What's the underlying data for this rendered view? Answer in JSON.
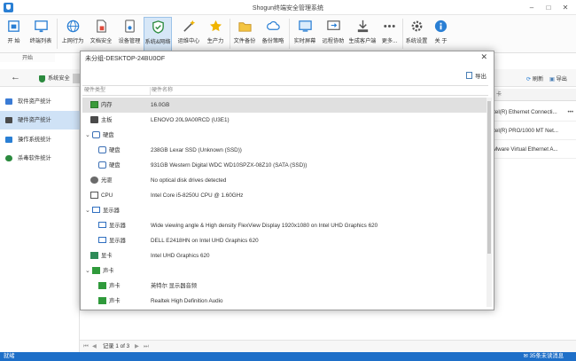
{
  "window": {
    "title": "Shogun终端安全管理系统"
  },
  "ribbon": {
    "buttons": [
      {
        "label": "开 始",
        "icon": "home-icon"
      },
      {
        "label": "终端列表",
        "icon": "monitor-list-icon"
      },
      {
        "label": "上网行为",
        "icon": "globe-icon"
      },
      {
        "label": "文档安全",
        "icon": "document-icon"
      },
      {
        "label": "设备管理",
        "icon": "device-icon"
      },
      {
        "label": "系统&网络",
        "icon": "shield-icon"
      },
      {
        "label": "运维中心",
        "icon": "wand-icon"
      },
      {
        "label": "生产力",
        "icon": "star-icon"
      },
      {
        "label": "文件备份",
        "icon": "folder-icon"
      },
      {
        "label": "备份策略",
        "icon": "cloud-icon"
      },
      {
        "label": "实时屏幕",
        "icon": "screen-icon"
      },
      {
        "label": "远程协助",
        "icon": "remote-icon"
      },
      {
        "label": "生成客户端",
        "icon": "download-icon"
      },
      {
        "label": "更多...",
        "icon": "more-icon"
      },
      {
        "label": "系统设置",
        "icon": "gear-icon"
      },
      {
        "label": "关 于",
        "icon": "info-icon"
      }
    ],
    "group_label": "开始"
  },
  "nav": {
    "tab_label": "系统安全",
    "refresh_label": "刷新",
    "export_label": "导出"
  },
  "sidebar": {
    "items": [
      {
        "label": "软件资产统计"
      },
      {
        "label": "硬件资产统计"
      },
      {
        "label": "操作系统统计"
      },
      {
        "label": "杀毒软件统计"
      }
    ]
  },
  "background_list": {
    "header": "卡",
    "rows": [
      "Intel(R) Ethernet Connecti...",
      "Intel(R) PRO/1000 MT Net...",
      "VMware Virtual Ethernet A..."
    ]
  },
  "pager": {
    "text": "记录 1 of 3"
  },
  "status": {
    "left": "就绪",
    "right": "35条未读消息"
  },
  "modal": {
    "title": "未分组-DESKTOP-24BU0OF",
    "export_label": "导出",
    "columns": [
      "硬件类型",
      "硬件名称"
    ],
    "rows": [
      {
        "type": "内存",
        "name": "16.0GB",
        "icon": "ram"
      },
      {
        "type": "主板",
        "name": "LENOVO 20L9A00RCD (U3E1)",
        "icon": "board"
      },
      {
        "type": "硬盘",
        "name": "",
        "icon": "disk",
        "group": true
      },
      {
        "type": "硬盘",
        "name": "238GB Lexar SSD (Unknown (SSD))",
        "icon": "disk",
        "child": true
      },
      {
        "type": "硬盘",
        "name": "931GB Western Digital WDC WD10SPZX-08Z10 (SATA (SSD))",
        "icon": "disk",
        "child": true
      },
      {
        "type": "光驱",
        "name": "No optical disk drives detected",
        "icon": "optical"
      },
      {
        "type": "CPU",
        "name": "Intel Core i5-8250U CPU @ 1.60GHz",
        "icon": "cpu"
      },
      {
        "type": "显示器",
        "name": "",
        "icon": "mon",
        "group": true
      },
      {
        "type": "显示器",
        "name": "Wide viewing angle & High density FlexView Display 1920x1080 on Intel UHD Graphics 620",
        "icon": "mon",
        "child": true
      },
      {
        "type": "显示器",
        "name": "DELL E2418HN on Intel UHD Graphics 620",
        "icon": "mon",
        "child": true
      },
      {
        "type": "显卡",
        "name": "Intel UHD Graphics 620",
        "icon": "gpu"
      },
      {
        "type": "声卡",
        "name": "",
        "icon": "snd",
        "group": true
      },
      {
        "type": "声卡",
        "name": "英特尔 显示器音频",
        "icon": "snd",
        "child": true
      },
      {
        "type": "声卡",
        "name": "Realtek High Definition Audio",
        "icon": "snd",
        "child": true
      }
    ]
  },
  "colors": {
    "accent": "#1e6fc8",
    "selected_side": "#cfe2f6"
  }
}
